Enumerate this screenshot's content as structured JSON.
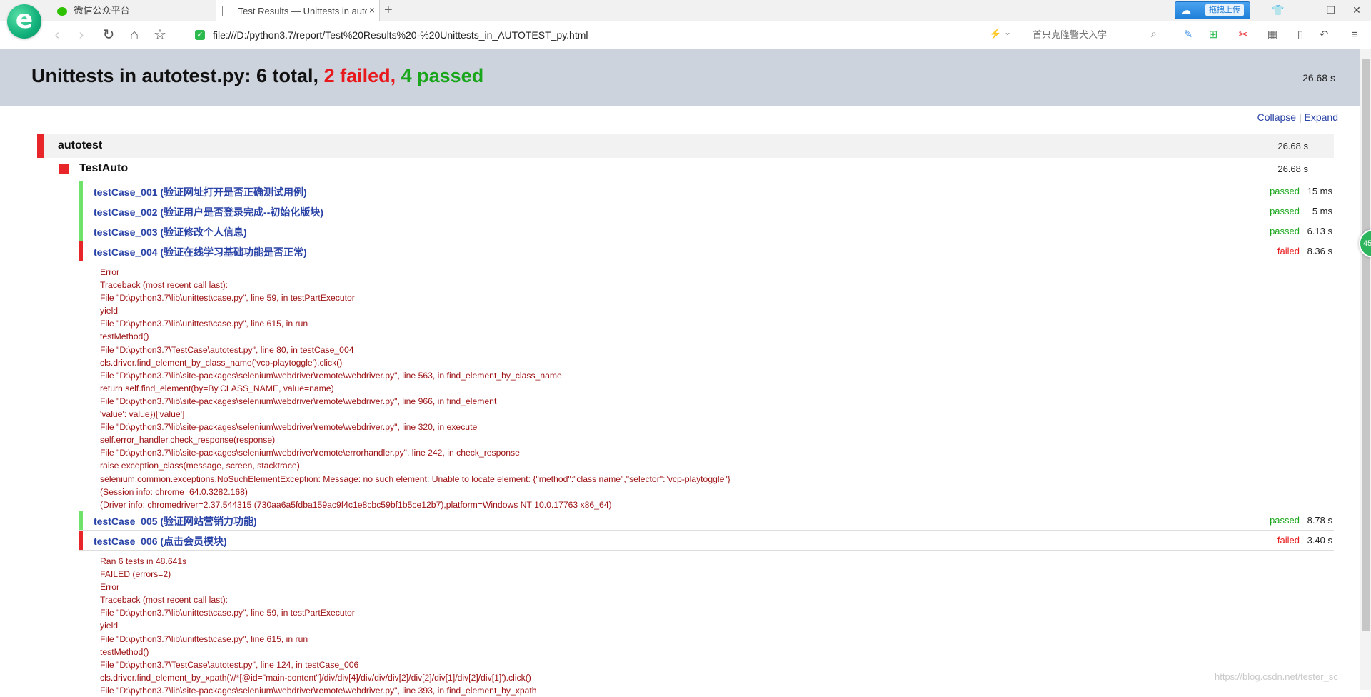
{
  "browser": {
    "logo_letter": "e",
    "tabs": [
      {
        "title": "微信公众平台"
      },
      {
        "title": "Test Results — Unittests in autotest.py"
      }
    ],
    "new_tab": "+",
    "close_tab": "×",
    "cloud_upload_label": "拖拽上传",
    "url": "file:///D:/python3.7/report/Test%20Results%20-%20Unittests_in_AUTOTEST_py.html",
    "search_placeholder": "首只克隆警犬入学",
    "window_controls": {
      "minimize": "–",
      "restore": "❐",
      "close": "✕"
    },
    "accent": "#11b07a"
  },
  "report": {
    "title_prefix": "Unittests in autotest.py: 6 total,",
    "failed_text": "2 failed,",
    "passed_text": "4 passed",
    "total_duration": "26.68 s",
    "collapse_label": "Collapse",
    "separator": "|",
    "expand_label": "Expand",
    "suite": {
      "name": "autotest",
      "duration": "26.68 s"
    },
    "test_class": {
      "name": "TestAuto",
      "duration": "26.68 s"
    },
    "tests": [
      {
        "name": "testCase_001 (验证网址打开是否正确测试用例)",
        "status": "passed",
        "duration": "15 ms"
      },
      {
        "name": "testCase_002 (验证用户是否登录完成--初始化版块)",
        "status": "passed",
        "duration": "5 ms"
      },
      {
        "name": "testCase_003 (验证修改个人信息)",
        "status": "passed",
        "duration": "6.13 s"
      },
      {
        "name": "testCase_004 (验证在线学习基础功能是否正常)",
        "status": "failed",
        "duration": "8.36 s"
      },
      {
        "name": "testCase_005 (验证网站营销力功能)",
        "status": "passed",
        "duration": "8.78 s"
      },
      {
        "name": "testCase_006 (点击会员模块)",
        "status": "failed",
        "duration": "3.40 s"
      }
    ],
    "trace_004": "Error\nTraceback (most recent call last):\nFile \"D:\\python3.7\\lib\\unittest\\case.py\", line 59, in testPartExecutor\nyield\nFile \"D:\\python3.7\\lib\\unittest\\case.py\", line 615, in run\ntestMethod()\nFile \"D:\\python3.7\\TestCase\\autotest.py\", line 80, in testCase_004\ncls.driver.find_element_by_class_name('vcp-playtoggle').click()\nFile \"D:\\python3.7\\lib\\site-packages\\selenium\\webdriver\\remote\\webdriver.py\", line 563, in find_element_by_class_name\nreturn self.find_element(by=By.CLASS_NAME, value=name)\nFile \"D:\\python3.7\\lib\\site-packages\\selenium\\webdriver\\remote\\webdriver.py\", line 966, in find_element\n'value': value})['value']\nFile \"D:\\python3.7\\lib\\site-packages\\selenium\\webdriver\\remote\\webdriver.py\", line 320, in execute\nself.error_handler.check_response(response)\nFile \"D:\\python3.7\\lib\\site-packages\\selenium\\webdriver\\remote\\errorhandler.py\", line 242, in check_response\nraise exception_class(message, screen, stacktrace)\nselenium.common.exceptions.NoSuchElementException: Message: no such element: Unable to locate element: {\"method\":\"class name\",\"selector\":\"vcp-playtoggle\"}\n(Session info: chrome=64.0.3282.168)\n(Driver info: chromedriver=2.37.544315 (730aa6a5fdba159ac9f4c1e8cbc59bf1b5ce12b7),platform=Windows NT 10.0.17763 x86_64)",
    "trace_006": "Ran 6 tests in 48.641s\nFAILED (errors=2)\nError\nTraceback (most recent call last):\nFile \"D:\\python3.7\\lib\\unittest\\case.py\", line 59, in testPartExecutor\nyield\nFile \"D:\\python3.7\\lib\\unittest\\case.py\", line 615, in run\ntestMethod()\nFile \"D:\\python3.7\\TestCase\\autotest.py\", line 124, in testCase_006\ncls.driver.find_element_by_xpath('//*[@id=\"main-content\"]/div/div[4]/div/div/div[2]/div[2]/div[1]/div[2]/div[1]').click()\nFile \"D:\\python3.7\\lib\\site-packages\\selenium\\webdriver\\remote\\webdriver.py\", line 393, in find_element_by_xpath",
    "colors": {
      "failed": "#e8191c",
      "passed": "#19a61b",
      "link": "#2a43a7",
      "header_bg": "#cdd3dd"
    }
  },
  "widget_text": "45",
  "watermark": "https://blog.csdn.net/tester_sc"
}
